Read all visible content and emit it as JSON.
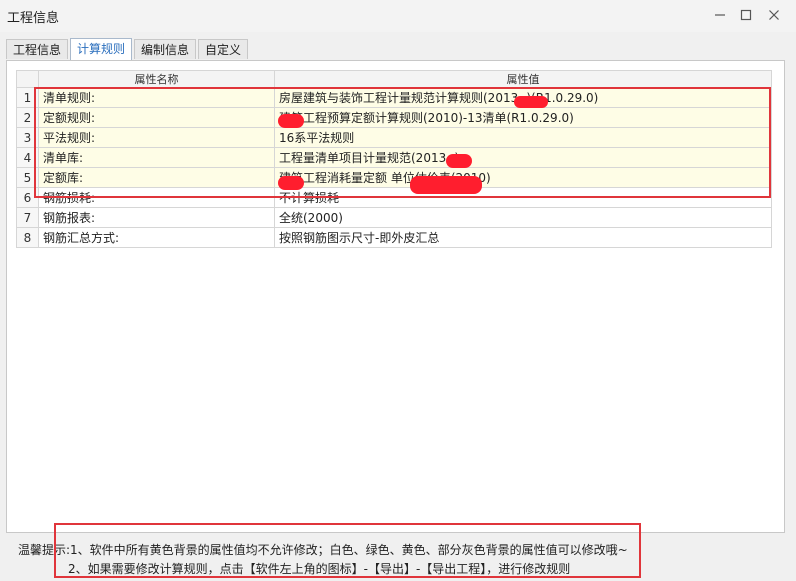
{
  "window": {
    "title": "工程信息",
    "controls": [
      "minimize-icon",
      "maximize-icon",
      "close-icon"
    ]
  },
  "tabs": [
    {
      "label": "工程信息",
      "active": false
    },
    {
      "label": "计算规则",
      "active": true
    },
    {
      "label": "编制信息",
      "active": false
    },
    {
      "label": "自定义",
      "active": false
    }
  ],
  "table": {
    "columns": [
      "属性名称",
      "属性值"
    ],
    "rows": [
      {
        "num": "1",
        "name": "清单规则:",
        "value": "房屋建筑与装饰工程计量规范计算规则(2013-    )(R1.0.29.0)",
        "bg": "yellow"
      },
      {
        "num": "2",
        "name": "定额规则:",
        "value": "    建筑工程预算定额计算规则(2010)-13清单(R1.0.29.0)",
        "bg": "yellow"
      },
      {
        "num": "3",
        "name": "平法规则:",
        "value": "16系平法规则",
        "bg": "yellow"
      },
      {
        "num": "4",
        "name": "清单库:",
        "value": "工程量清单项目计量规范(2013-    )",
        "bg": "yellow"
      },
      {
        "num": "5",
        "name": "定额库:",
        "value": "    建筑工程消耗量定额              单位估价表(2010)",
        "bg": "yellow"
      },
      {
        "num": "6",
        "name": "钢筋损耗:",
        "value": "不计算损耗",
        "bg": "white"
      },
      {
        "num": "7",
        "name": "钢筋报表:",
        "value": "全统(2000)",
        "bg": "white"
      },
      {
        "num": "8",
        "name": "钢筋汇总方式:",
        "value": "按照钢筋图示尺寸-即外皮汇总",
        "bg": "white"
      }
    ]
  },
  "tips": {
    "line1": "温馨提示:1、软件中所有黄色背景的属性值均不允许修改；白色、绿色、黄色、部分灰色背景的属性值可以修改哦~",
    "line2": "2、如果需要修改计算规则，点击【软件左上角的图标】-【导出】-【导出工程】，进行修改规则"
  },
  "colors": {
    "highlight_border": "#e0353b",
    "readonly_background": "#fefde6",
    "active_tab_text": "#2a6ebd"
  }
}
